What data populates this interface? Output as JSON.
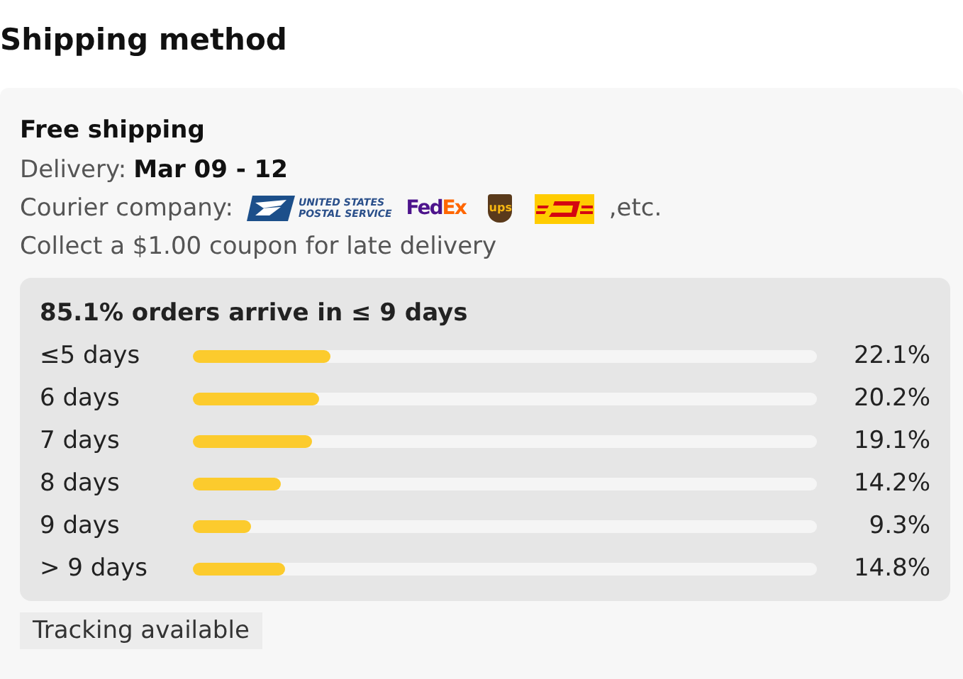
{
  "title": "Shipping method",
  "option": {
    "name": "Free shipping",
    "delivery_label": "Delivery:",
    "delivery_value": "Mar 09 - 12",
    "courier_label": "Courier company:",
    "couriers": [
      {
        "kind": "usps",
        "lines": [
          "UNITED STATES",
          "POSTAL SERVICE"
        ]
      },
      {
        "kind": "fedex",
        "lines": [
          "Fed",
          "Ex"
        ]
      },
      {
        "kind": "ups",
        "lines": [
          "ups"
        ]
      },
      {
        "kind": "dhl"
      }
    ],
    "courier_suffix": ",etc.",
    "coupon": "Collect a $1.00 coupon for late delivery"
  },
  "stats": {
    "heading": "85.1% orders arrive in ≤ 9 days",
    "rows": [
      {
        "label": "≤5 days",
        "level": 0.221,
        "reading": "22.1%"
      },
      {
        "label": "6 days",
        "level": 0.202,
        "reading": "20.2%"
      },
      {
        "label": "7 days",
        "level": 0.191,
        "reading": "19.1%"
      },
      {
        "label": "8 days",
        "level": 0.142,
        "reading": "14.2%"
      },
      {
        "label": "9 days",
        "level": 0.093,
        "reading": "9.3%"
      },
      {
        "label": "> 9 days",
        "level": 0.148,
        "reading": "14.8%"
      }
    ]
  },
  "tags": [
    "Tracking available"
  ]
}
